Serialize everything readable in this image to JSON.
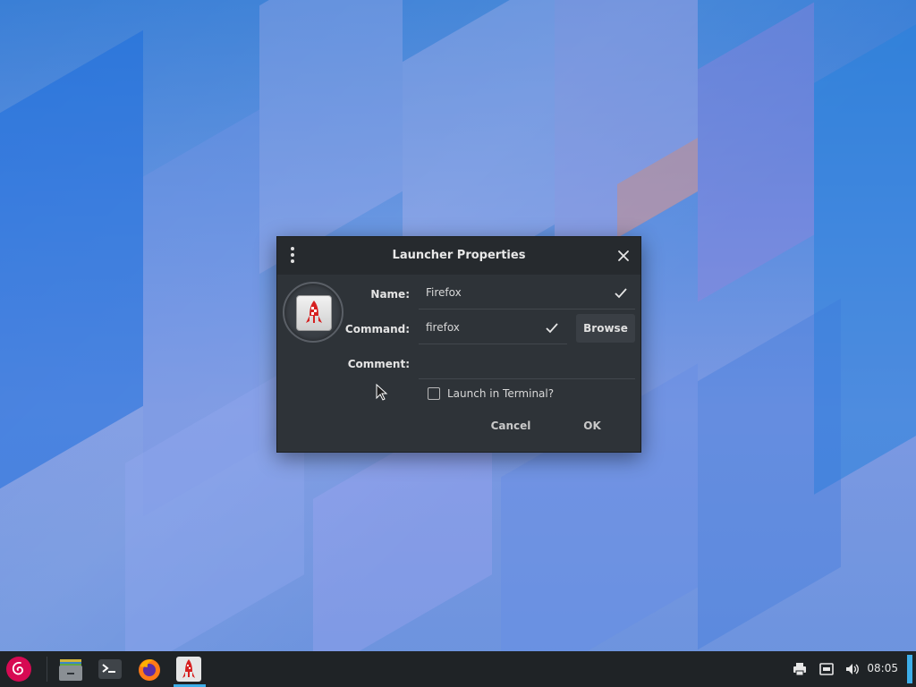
{
  "dialog": {
    "title": "Launcher Properties",
    "name_label": "Name:",
    "name_value": "Firefox",
    "command_label": "Command:",
    "command_value": "firefox",
    "comment_label": "Comment:",
    "comment_value": "",
    "browse_label": "Browse",
    "terminal_checkbox_label": "Launch in Terminal?",
    "terminal_checked": false,
    "cancel_label": "Cancel",
    "ok_label": "OK",
    "launcher_icon": "rocket-icon"
  },
  "taskbar": {
    "start_icon": "debian-swirl-icon",
    "tasks": [
      {
        "name": "file-manager-icon"
      },
      {
        "name": "terminal-icon"
      },
      {
        "name": "firefox-icon"
      },
      {
        "name": "rocket-launcher-icon",
        "active": true
      }
    ],
    "tray": [
      "printer-icon",
      "network-icon",
      "volume-icon"
    ],
    "clock": "08:05"
  },
  "colors": {
    "dialog_bg": "#2e3338",
    "titlebar_bg": "#262a2e",
    "accent": "#3daee9",
    "taskbar_bg": "#1f2326",
    "debian_red": "#d70a53"
  }
}
